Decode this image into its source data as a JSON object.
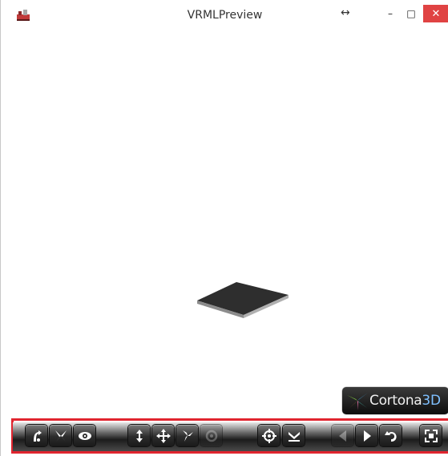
{
  "window": {
    "title": "VRMLPreview",
    "resize_glyph": "↔",
    "minimize_glyph": "–",
    "maximize_glyph": "□",
    "close_glyph": "✕"
  },
  "viewer": {
    "brand": {
      "text_main": "Cortona",
      "text_accent": "3D"
    }
  },
  "toolbar": {
    "accent_color": "#e0252f",
    "buttons": [
      {
        "icon": "walk-mode-icon"
      },
      {
        "icon": "fly-mode-icon"
      },
      {
        "icon": "study-mode-icon"
      },
      {
        "icon": "plan-icon"
      },
      {
        "icon": "pan-icon"
      },
      {
        "icon": "turn-icon"
      },
      {
        "icon": "roll-icon"
      },
      {
        "icon": "goto-icon"
      },
      {
        "icon": "align-icon"
      },
      {
        "icon": "previous-viewpoint-icon"
      },
      {
        "icon": "next-viewpoint-icon"
      },
      {
        "icon": "restore-icon"
      },
      {
        "icon": "fit-icon"
      }
    ]
  }
}
